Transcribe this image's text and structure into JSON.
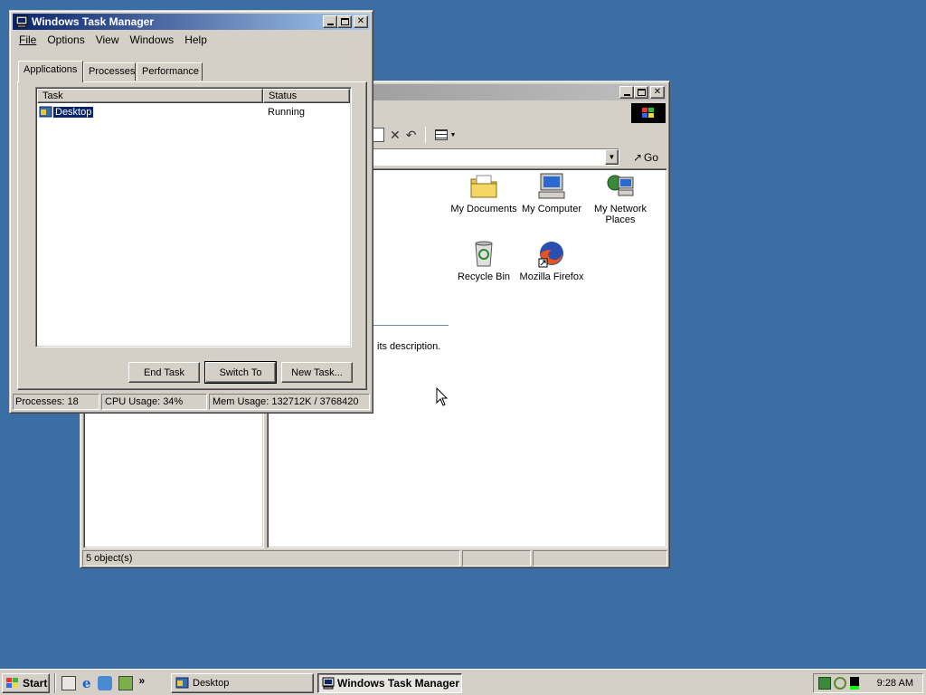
{
  "taskmgr": {
    "title": "Windows Task Manager",
    "menu": [
      "File",
      "Options",
      "View",
      "Windows",
      "Help"
    ],
    "tabs": [
      "Applications",
      "Processes",
      "Performance"
    ],
    "columns": [
      "Task",
      "Status"
    ],
    "rows": [
      {
        "task": "Desktop",
        "status": "Running"
      }
    ],
    "buttons": {
      "end_task": "End Task",
      "switch_to": "Switch To",
      "new_task": "New Task..."
    },
    "status": {
      "processes": "Processes: 18",
      "cpu": "CPU Usage: 34%",
      "mem": "Mem Usage: 132712K / 3768420"
    }
  },
  "explorer": {
    "go_label": "Go",
    "description_fragment": "its description.",
    "status_text": "5 object(s)",
    "icons": [
      {
        "label": "My Documents",
        "icon": "folder-icon"
      },
      {
        "label": "My Computer",
        "icon": "computer-icon"
      },
      {
        "label": "My Network Places",
        "icon": "network-icon"
      },
      {
        "label": "Recycle Bin",
        "icon": "recycle-bin-icon"
      },
      {
        "label": "Mozilla Firefox",
        "icon": "firefox-icon"
      }
    ]
  },
  "taskbar": {
    "start_label": "Start",
    "buttons": [
      "Desktop",
      "Windows Task Manager"
    ],
    "chevron": "»",
    "clock": "9:28 AM"
  },
  "colors": {
    "desktop": "#3a6ea5",
    "title_active": "#0a246a",
    "face": "#d4d0c8",
    "selection": "#0a246a"
  }
}
